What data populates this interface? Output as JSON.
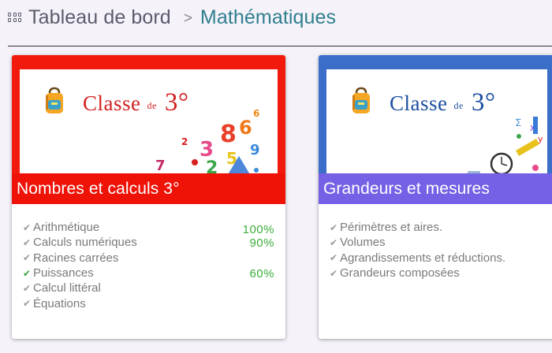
{
  "breadcrumb": {
    "home_label": "Tableau de bord",
    "separator": ">",
    "current_label": "Mathématiques"
  },
  "cards": [
    {
      "title": "Nombres et calculs 3°",
      "banner": {
        "word": "Classe",
        "small": "de",
        "num": "3°"
      },
      "accent_color": "#f11a0c",
      "items": [
        {
          "label": "Arithmétique",
          "progress": "100%",
          "completed": false
        },
        {
          "label": "Calculs numériques",
          "progress": "90%",
          "completed": false
        },
        {
          "label": "Racines carrées",
          "progress": "",
          "completed": false
        },
        {
          "label": "Puissances",
          "progress": "60%",
          "completed": true
        },
        {
          "label": "Calcul littéral",
          "progress": "",
          "completed": false
        },
        {
          "label": "Équations",
          "progress": "",
          "completed": false
        }
      ]
    },
    {
      "title": "Grandeurs et mesures",
      "banner": {
        "word": "Classe",
        "small": "de",
        "num": "3°"
      },
      "accent_color": "#7461e6",
      "items": [
        {
          "label": "Périmètres et aires."
        },
        {
          "label": "Volumes"
        },
        {
          "label": "Agrandissements et réductions."
        },
        {
          "label": "Grandeurs composées"
        }
      ]
    }
  ]
}
